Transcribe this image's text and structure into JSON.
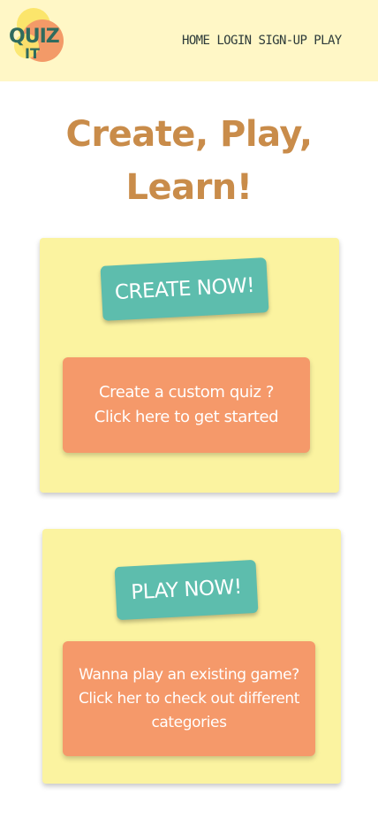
{
  "header": {
    "logo_text": "QUIZ IT",
    "nav": [
      "HOME",
      "LOGIN",
      "SIGN-UP",
      "PLAY"
    ]
  },
  "hero": {
    "line1": "Create, Play,",
    "line2": "Learn!"
  },
  "create_card": {
    "button_label": "CREATE NOW!",
    "info_line1": "Create a custom quiz ?",
    "info_line2": "Click here to get started"
  },
  "play_card": {
    "button_label": "PLAY NOW!",
    "info_line1": "Wanna play an existing game?",
    "info_line2": "Click her to check out different",
    "info_line3": "categories"
  },
  "colors": {
    "header_bg": "#fff7c6",
    "card_bg": "#fbf3a0",
    "title": "#c98c4a",
    "teal_button": "#5dbdad",
    "orange_box": "#f5996a",
    "logo_text": "#2f6b5e",
    "logo_blob_yellow": "#fbe56b",
    "logo_blob_orange": "#f39a68"
  }
}
